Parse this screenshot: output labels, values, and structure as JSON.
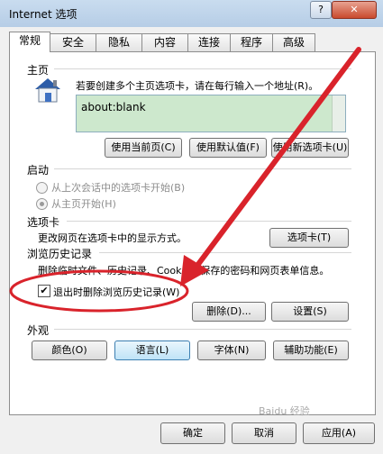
{
  "window": {
    "title": "Internet 选项",
    "help_label": "?",
    "close_label": "✕"
  },
  "tabs": [
    {
      "label": "常规"
    },
    {
      "label": "安全"
    },
    {
      "label": "隐私"
    },
    {
      "label": "内容"
    },
    {
      "label": "连接"
    },
    {
      "label": "程序"
    },
    {
      "label": "高级"
    }
  ],
  "home": {
    "section": "主页",
    "description": "若要创建多个主页选项卡，请在每行输入一个地址(R)。",
    "url": "about:blank",
    "use_current": "使用当前页(C)",
    "use_default": "使用默认值(F)",
    "use_new_tab": "使用新选项卡(U)"
  },
  "startup": {
    "section": "启动",
    "option1": "从上次会话中的选项卡开始(B)",
    "option2": "从主页开始(H)"
  },
  "tabsection": {
    "section": "选项卡",
    "description": "更改网页在选项卡中的显示方式。",
    "button": "选项卡(T)"
  },
  "history": {
    "section": "浏览历史记录",
    "description": "删除临时文件、历史记录、Cookie、保存的密码和网页表单信息。",
    "checkbox_label": "退出时删除浏览历史记录(W)",
    "delete_button": "删除(D)...",
    "settings_button": "设置(S)"
  },
  "appearance": {
    "section": "外观",
    "colors": "颜色(O)",
    "languages": "语言(L)",
    "fonts": "字体(N)",
    "accessibility": "辅助功能(E)"
  },
  "footer": {
    "ok": "确定",
    "cancel": "取消",
    "apply": "应用(A)"
  },
  "watermark": "Baidu 经验"
}
